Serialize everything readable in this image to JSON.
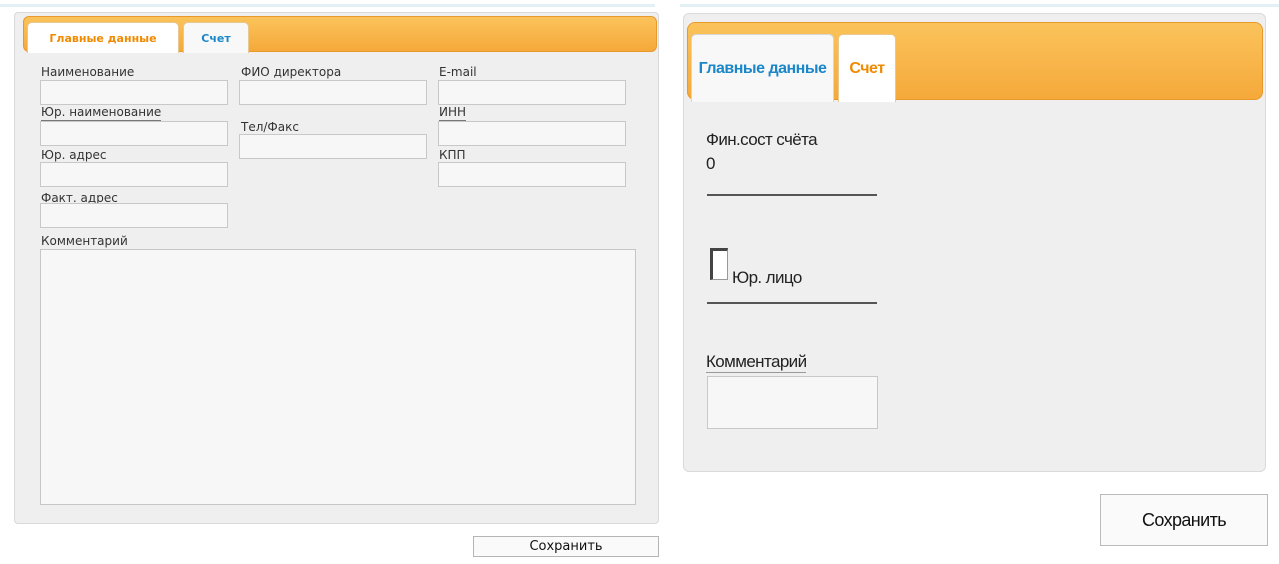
{
  "left_form": {
    "tabs": [
      "Главные данные",
      "Счет"
    ],
    "active_tab": 0,
    "fields": {
      "name_label": "Наименование",
      "legal_name_label": "Юр. наименование",
      "legal_address_label": "Юр. адрес",
      "actual_address_label": "Факт. адрес",
      "director_label": "ФИО директора",
      "phone_fax_label": "Тел/Факс",
      "email_label": "E-mail",
      "inn_label": "ИНН",
      "kpp_label": "КПП"
    },
    "comment_label": "Комментарий",
    "save_label": "Сохранить"
  },
  "right_form": {
    "tabs": [
      "Главные данные",
      "Счет"
    ],
    "active_tab": 1,
    "balance_label": "Фин.сост счёта",
    "balance_value": "0",
    "legal_entity_label": "Юр. лицо",
    "legal_entity_checked": false,
    "comment_label": "Комментарий",
    "save_label": "Сохранить"
  },
  "colors": {
    "tab_bar": "#f5a93a",
    "active_tab_text": "#f08a00",
    "inactive_tab_text": "#1b87c9",
    "panel_bg": "#efefef"
  }
}
